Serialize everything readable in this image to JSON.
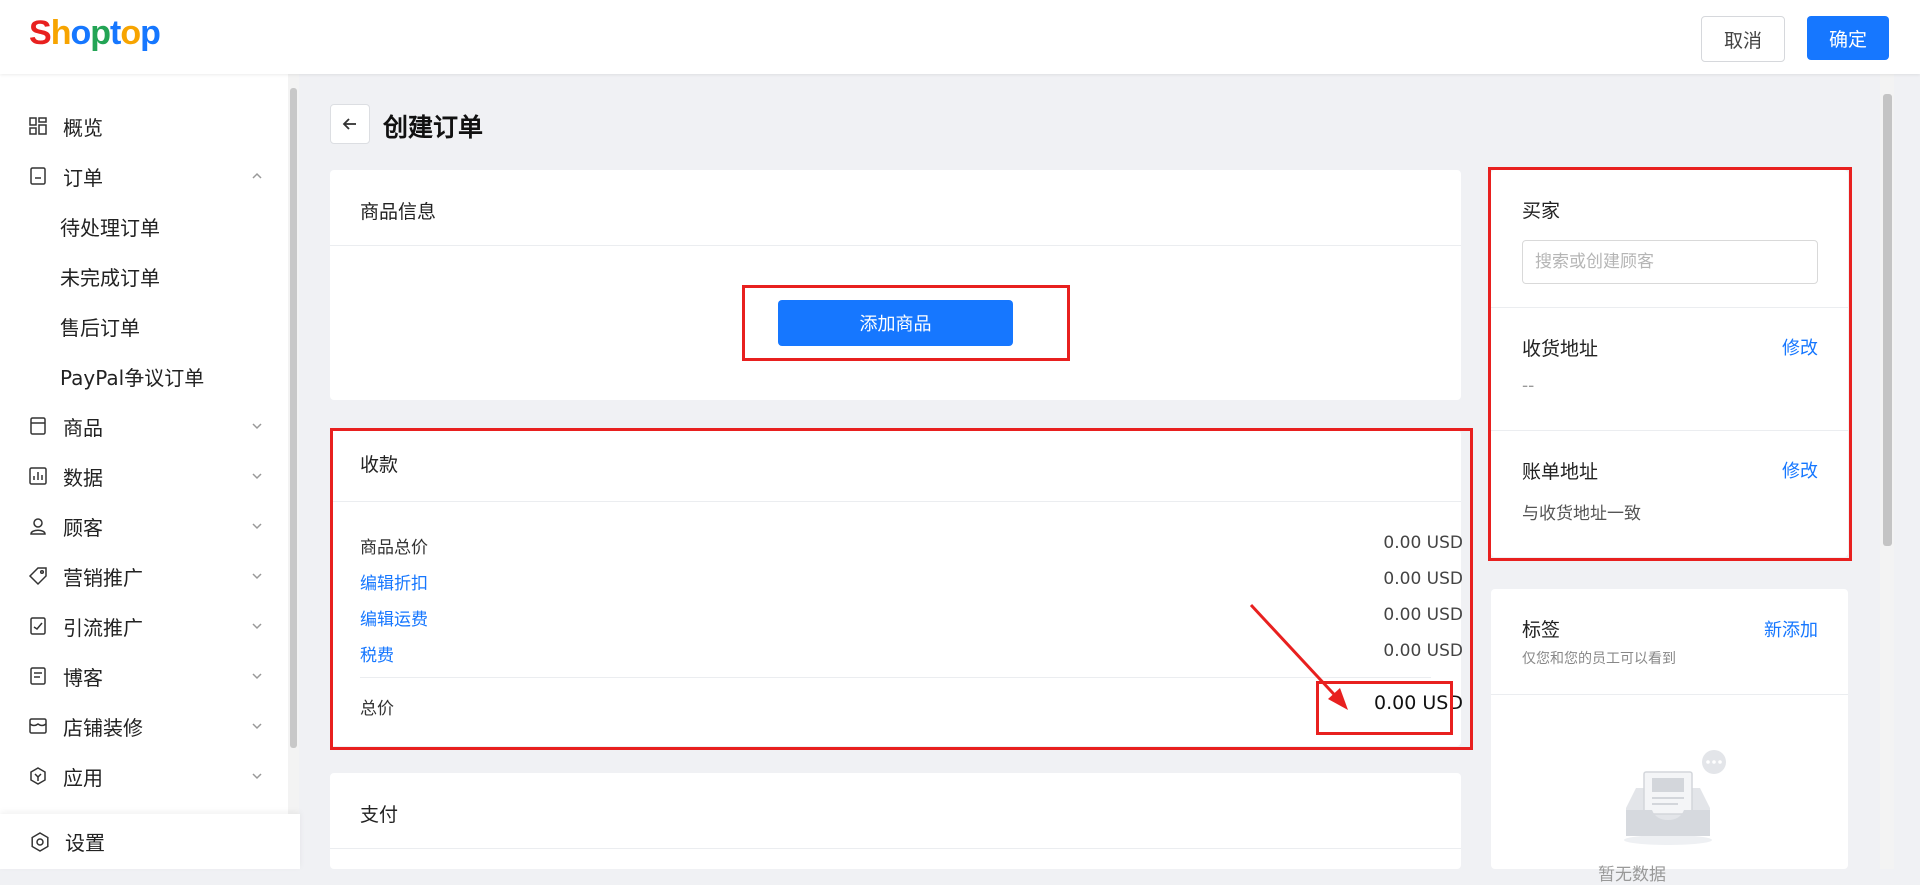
{
  "app": {
    "logo": "Shoptop",
    "logo_colors": [
      "#e8201f",
      "#f7a400",
      "#1677ff",
      "#23a455"
    ]
  },
  "header": {
    "cancel_label": "取消",
    "confirm_label": "确定"
  },
  "sidebar": {
    "items": [
      {
        "label": "概览",
        "icon": "dashboard-icon"
      },
      {
        "label": "订单",
        "icon": "order-icon",
        "expanded": true
      },
      {
        "label": "待处理订单"
      },
      {
        "label": "未完成订单"
      },
      {
        "label": "售后订单"
      },
      {
        "label": "PayPal争议订单"
      },
      {
        "label": "商品",
        "icon": "product-icon"
      },
      {
        "label": "数据",
        "icon": "chart-icon"
      },
      {
        "label": "顾客",
        "icon": "user-icon"
      },
      {
        "label": "营销推广",
        "icon": "tag-icon"
      },
      {
        "label": "引流推广",
        "icon": "traffic-icon"
      },
      {
        "label": "博客",
        "icon": "blog-icon"
      },
      {
        "label": "店铺装修",
        "icon": "store-icon"
      },
      {
        "label": "应用",
        "icon": "app-icon"
      }
    ],
    "settings_label": "设置"
  },
  "page": {
    "title": "创建订单"
  },
  "products": {
    "title": "商品信息",
    "add_button": "添加商品"
  },
  "payment_summary": {
    "title": "收款",
    "rows": [
      {
        "label": "商品总价",
        "value": "0.00 USD",
        "link": false
      },
      {
        "label": "编辑折扣",
        "value": "0.00 USD",
        "link": true
      },
      {
        "label": "编辑运费",
        "value": "0.00 USD",
        "link": true
      },
      {
        "label": "税费",
        "value": "0.00 USD",
        "link": true
      }
    ],
    "total_label": "总价",
    "total_value": "0.00 USD"
  },
  "payment": {
    "title": "支付"
  },
  "buyer": {
    "title": "买家",
    "search_placeholder": "搜索或创建顾客",
    "shipping_title": "收货地址",
    "shipping_edit": "修改",
    "shipping_value": "--",
    "billing_title": "账单地址",
    "billing_edit": "修改",
    "billing_value": "与收货地址一致"
  },
  "tags": {
    "title": "标签",
    "add_link": "新添加",
    "subtitle": "仅您和您的员工可以看到",
    "empty_text": "暂无数据"
  }
}
